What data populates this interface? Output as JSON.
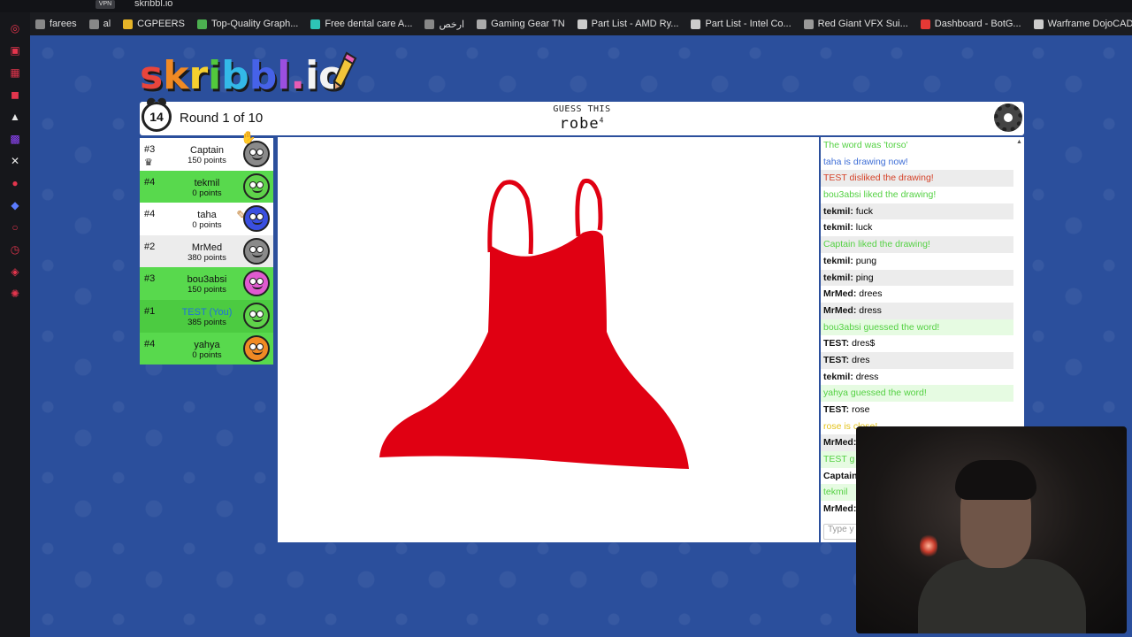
{
  "browser": {
    "url": "skribbl.io",
    "vpn_label": "VPN",
    "bookmarks": [
      {
        "label": "farees",
        "color": "#888888"
      },
      {
        "label": "al",
        "color": "#888888"
      },
      {
        "label": "CGPEERS",
        "color": "#e6b428"
      },
      {
        "label": "Top-Quality Graph...",
        "color": "#4caf50"
      },
      {
        "label": "Free dental care A...",
        "color": "#2ec4b6"
      },
      {
        "label": "ارخص",
        "color": "#888888"
      },
      {
        "label": "Gaming Gear TN",
        "color": "#aaaaaa"
      },
      {
        "label": "Part List - AMD Ry...",
        "color": "#cccccc"
      },
      {
        "label": "Part List - Intel Co...",
        "color": "#cccccc"
      },
      {
        "label": "Red Giant VFX Sui...",
        "color": "#999999"
      },
      {
        "label": "Dashboard - BotG...",
        "color": "#e53935"
      },
      {
        "label": "Warframe DojoCAD",
        "color": "#cccccc"
      }
    ]
  },
  "game": {
    "logo_letters": [
      {
        "ch": "s",
        "color": "#e8453c"
      },
      {
        "ch": "k",
        "color": "#f08a24"
      },
      {
        "ch": "r",
        "color": "#f6d02f"
      },
      {
        "ch": "i",
        "color": "#52c93c"
      },
      {
        "ch": "b",
        "color": "#33b9e8"
      },
      {
        "ch": "b",
        "color": "#4662e8"
      },
      {
        "ch": "l",
        "color": "#9b4fe0"
      },
      {
        "ch": ".",
        "color": "#e85cb5"
      },
      {
        "ch": "i",
        "color": "#f3f3f3"
      },
      {
        "ch": "o",
        "color": "#f3f3f3"
      }
    ],
    "timer": "14",
    "round": "Round 1 of 10",
    "guess_label": "GUESS THIS",
    "word": "robe",
    "word_length": "4"
  },
  "players": [
    {
      "rank": "#3",
      "name": "Captain",
      "points": "150 points",
      "bg": "white",
      "avatar": "#8a8a8a",
      "crown": true
    },
    {
      "rank": "#4",
      "name": "tekmil",
      "points": "0 points",
      "bg": "green",
      "avatar": "#5fd24a"
    },
    {
      "rank": "#4",
      "name": "taha",
      "points": "0 points",
      "bg": "white",
      "avatar": "#3a4fe0",
      "drawing": true
    },
    {
      "rank": "#2",
      "name": "MrMed",
      "points": "380 points",
      "bg": "alt",
      "avatar": "#8a8a8a"
    },
    {
      "rank": "#3",
      "name": "bou3absi",
      "points": "150 points",
      "bg": "green",
      "avatar": "#e05ad0"
    },
    {
      "rank": "#1",
      "name": "TEST (You)",
      "points": "385 points",
      "bg": "green-alt",
      "avatar": "#5fd24a",
      "you": true
    },
    {
      "rank": "#4",
      "name": "yahya",
      "points": "0 points",
      "bg": "green",
      "avatar": "#f08a24"
    }
  ],
  "chat": {
    "messages": [
      {
        "text": "The word was 'torso'",
        "style": "green"
      },
      {
        "text": "taha is drawing now!",
        "style": "blue"
      },
      {
        "text": "TEST disliked the drawing!",
        "style": "red alt"
      },
      {
        "text": "bou3absi liked the drawing!",
        "style": "green"
      },
      {
        "author": "tekmil:",
        "text": " fuck",
        "style": "alt"
      },
      {
        "author": "tekmil:",
        "text": " luck",
        "style": ""
      },
      {
        "text": "Captain liked the drawing!",
        "style": "green alt"
      },
      {
        "author": "tekmil:",
        "text": " pung",
        "style": ""
      },
      {
        "author": "tekmil:",
        "text": " ping",
        "style": "alt"
      },
      {
        "author": "MrMed:",
        "text": " drees",
        "style": ""
      },
      {
        "author": "MrMed:",
        "text": " dress",
        "style": "alt"
      },
      {
        "text": "bou3absi guessed the word!",
        "style": "green gbg"
      },
      {
        "author": "TEST:",
        "text": " dres$",
        "style": ""
      },
      {
        "author": "TEST:",
        "text": " dres",
        "style": "alt"
      },
      {
        "author": "tekmil:",
        "text": " dress",
        "style": ""
      },
      {
        "text": "yahya guessed the word!",
        "style": "green gbg"
      },
      {
        "author": "TEST:",
        "text": " rose",
        "style": ""
      },
      {
        "text": "rose is close!",
        "style": "yellow"
      },
      {
        "author": "MrMed:",
        "text": "",
        "style": "alt"
      },
      {
        "text": "TEST g",
        "style": "green gbg"
      },
      {
        "author": "Captain",
        "text": "",
        "style": ""
      },
      {
        "text": "tekmil",
        "style": "green gbg"
      },
      {
        "author": "MrMed:",
        "text": "",
        "style": ""
      }
    ],
    "input_placeholder": "Type y"
  },
  "colors": {
    "background": "#2b4f9c",
    "drawing": "#e00012"
  }
}
